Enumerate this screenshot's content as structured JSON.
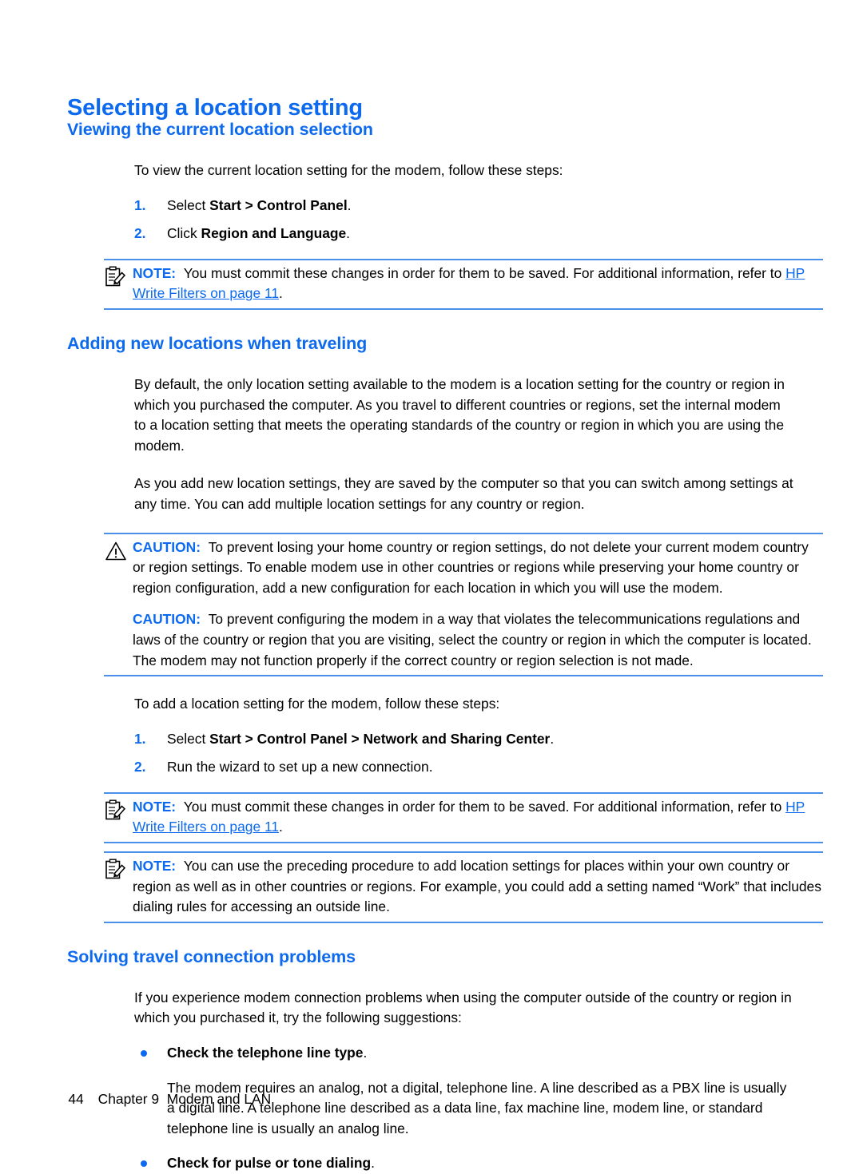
{
  "page": {
    "title": "Selecting a location setting",
    "footer": {
      "page_number": "44",
      "chapter": "Chapter 9",
      "chapter_title": "Modem and LAN"
    },
    "accent_color": "#0d6aef",
    "rule_color": "#4a90e8"
  },
  "section1": {
    "heading": "Viewing the current location selection",
    "intro": "To view the current location setting for the modem, follow these steps:",
    "steps": [
      {
        "num": "1.",
        "pre": "Select ",
        "bold": "Start > Control Panel",
        "post": "."
      },
      {
        "num": "2.",
        "pre": "Click ",
        "bold": "Region and Language",
        "post": "."
      }
    ],
    "note": {
      "icon": "note-clipboard-pencil-icon",
      "label": "NOTE:",
      "text_before_link": "You must commit these changes in order for them to be saved. For additional information, refer to ",
      "link": "HP Write Filters on page 11",
      "text_after_link": "."
    }
  },
  "section2": {
    "heading": "Adding new locations when traveling",
    "paragraphs": [
      "By default, the only location setting available to the modem is a location setting for the country or region in which you purchased the computer. As you travel to different countries or regions, set the internal modem to a location setting that meets the operating standards of the country or region in which you are using the modem.",
      "As you add new location settings, they are saved by the computer so that you can switch among settings at any time. You can add multiple location settings for any country or region."
    ],
    "cautions": [
      {
        "icon": "caution-warning-triangle-icon",
        "label": "CAUTION:",
        "text": "To prevent losing your home country or region settings, do not delete your current modem country or region settings. To enable modem use in other countries or regions while preserving your home country or region configuration, add a new configuration for each location in which you will use the modem."
      },
      {
        "icon": "",
        "label": "CAUTION:",
        "text": "To prevent configuring the modem in a way that violates the telecommunications regulations and laws of the country or region that you are visiting, select the country or region in which the computer is located. The modem may not function properly if the correct country or region selection is not made."
      }
    ],
    "add_intro": "To add a location setting for the modem, follow these steps:",
    "add_steps": [
      {
        "num": "1.",
        "pre": "Select ",
        "bold": "Start > Control Panel > Network and Sharing Center",
        "post": "."
      },
      {
        "num": "2.",
        "pre": "Run the wizard to set up a new connection.",
        "bold": "",
        "post": ""
      }
    ],
    "note1": {
      "icon": "note-clipboard-pencil-icon",
      "label": "NOTE:",
      "text_before_link": "You must commit these changes in order for them to be saved. For additional information, refer to ",
      "link": "HP Write Filters on page 11",
      "text_after_link": "."
    },
    "note2": {
      "icon": "note-clipboard-pencil-icon",
      "label": "NOTE:",
      "text": "You can use the preceding procedure to add location settings for places within your own country or region as well as in other countries or regions. For example, you could add a setting named “Work” that includes dialing rules for accessing an outside line."
    }
  },
  "section3": {
    "heading": "Solving travel connection problems",
    "intro": "If you experience modem connection problems when using the computer outside of the country or region in which you purchased it, try the following suggestions:",
    "bullets": [
      {
        "bold": "Check the telephone line type",
        "post": "."
      },
      {
        "bold": "Check for pulse or tone dialing",
        "post": "."
      }
    ],
    "bullet1_body": "The modem requires an analog, not a digital, telephone line. A line described as a PBX line is usually a digital line. A telephone line described as a data line, fax machine line, modem line, or standard telephone line is usually an analog line."
  }
}
